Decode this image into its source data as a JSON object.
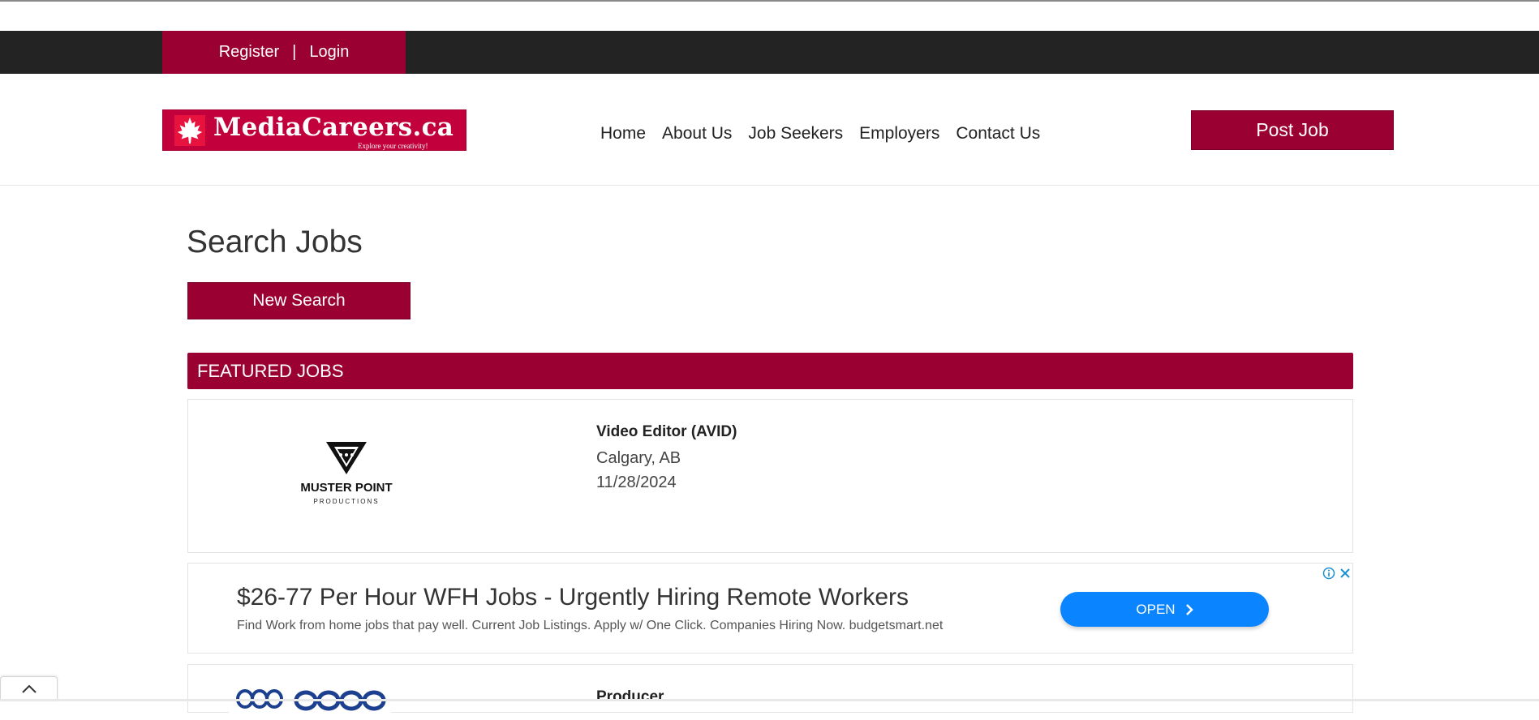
{
  "topbar": {
    "register_label": "Register",
    "separator": "|",
    "login_label": "Login"
  },
  "header": {
    "logo_text": "MediaCareers.ca",
    "logo_tagline": "Explore your creativity!",
    "nav": [
      {
        "label": "Home"
      },
      {
        "label": "About Us"
      },
      {
        "label": "Job Seekers"
      },
      {
        "label": "Employers"
      },
      {
        "label": "Contact Us"
      }
    ],
    "post_job_label": "Post Job"
  },
  "main": {
    "title": "Search Jobs",
    "new_search_label": "New Search",
    "featured_heading": "FEATURED JOBS",
    "jobs": [
      {
        "company_logo_line1": "MUSTER POINT",
        "company_logo_line2": "PRODUCTIONS",
        "title": "Video Editor (AVID)",
        "location": "Calgary, AB",
        "date": "11/28/2024"
      },
      {
        "title": "Producer"
      }
    ]
  },
  "ad": {
    "headline": "$26-77 Per Hour WFH Jobs - Urgently Hiring Remote Workers",
    "description": "Find Work from home jobs that pay well. Current Job Listings. Apply w/ One Click. Companies Hiring Now. budgetsmart.net",
    "cta_label": "OPEN"
  },
  "colors": {
    "brand": "#9b0033",
    "topbar": "#232323",
    "ad_button": "#0a84ff"
  },
  "icons": {
    "logo": "maple-leaf-icon",
    "ad_info": "info-icon",
    "ad_close": "close-icon",
    "ad_cta": "chevron-right-icon",
    "scroll": "chevron-up-icon"
  }
}
